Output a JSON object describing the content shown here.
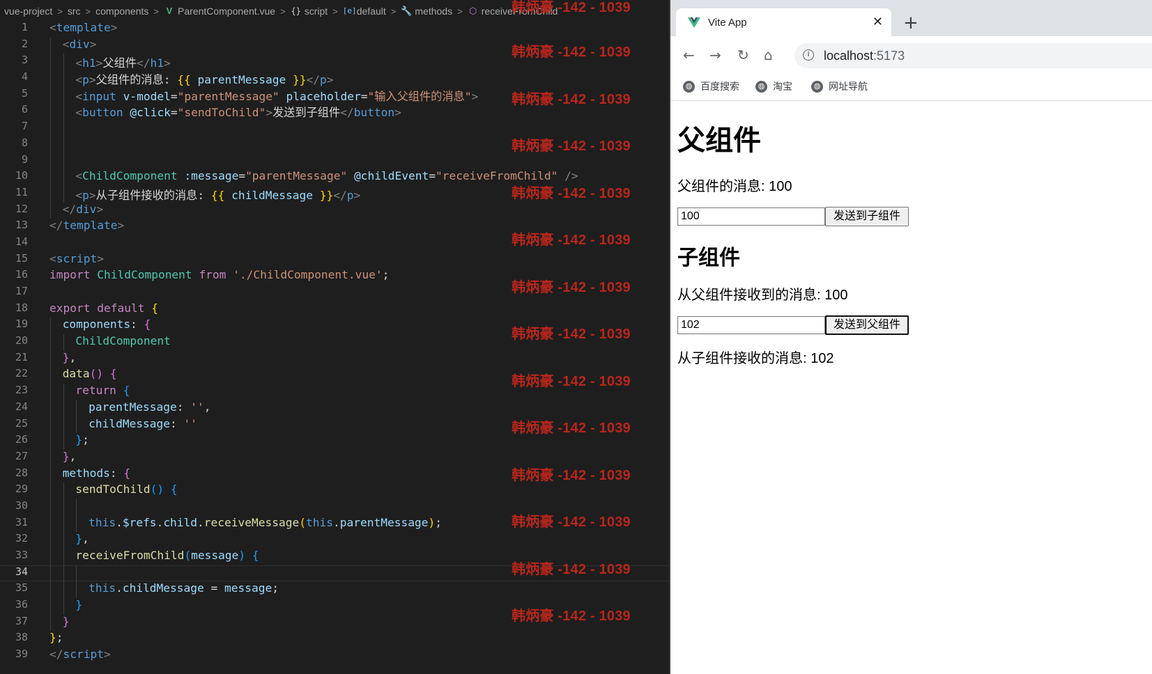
{
  "breadcrumb": {
    "items": [
      {
        "label": "vue-project",
        "icon": ""
      },
      {
        "label": "src",
        "icon": ""
      },
      {
        "label": "components",
        "icon": ""
      },
      {
        "label": "ParentComponent.vue",
        "icon": "vue-logo-icon"
      },
      {
        "label": "script",
        "icon": "braces-icon"
      },
      {
        "label": "default",
        "icon": "module-icon"
      },
      {
        "label": "methods",
        "icon": "wrench-icon"
      },
      {
        "label": "receiveFromChild",
        "icon": "cube-icon"
      }
    ]
  },
  "editor": {
    "current_line": 34,
    "lines": [
      {
        "n": "1",
        "indent": 0,
        "tokens": [
          [
            "p",
            "<"
          ],
          [
            "t",
            "template"
          ],
          [
            "p",
            ">"
          ]
        ]
      },
      {
        "n": "2",
        "indent": 1,
        "tokens": [
          [
            "p",
            "<"
          ],
          [
            "t",
            "div"
          ],
          [
            "p",
            ">"
          ]
        ]
      },
      {
        "n": "3",
        "indent": 2,
        "tokens": [
          [
            "p",
            "<"
          ],
          [
            "t",
            "h1"
          ],
          [
            "p",
            ">"
          ],
          [
            "d",
            "父组件"
          ],
          [
            "p",
            "</"
          ],
          [
            "t",
            "h1"
          ],
          [
            "p",
            ">"
          ]
        ]
      },
      {
        "n": "4",
        "indent": 2,
        "tokens": [
          [
            "p",
            "<"
          ],
          [
            "t",
            "p"
          ],
          [
            "p",
            ">"
          ],
          [
            "d",
            "父组件的消息: "
          ],
          [
            "y",
            "{{ "
          ],
          [
            "a",
            "parentMessage"
          ],
          [
            "y",
            " }}"
          ],
          [
            "p",
            "</"
          ],
          [
            "t",
            "p"
          ],
          [
            "p",
            ">"
          ]
        ]
      },
      {
        "n": "5",
        "indent": 2,
        "tokens": [
          [
            "p",
            "<"
          ],
          [
            "t",
            "input"
          ],
          [
            "d",
            " "
          ],
          [
            "a",
            "v-model"
          ],
          [
            "d",
            "="
          ],
          [
            "s",
            "\"parentMessage\""
          ],
          [
            "d",
            " "
          ],
          [
            "a",
            "placeholder"
          ],
          [
            "d",
            "="
          ],
          [
            "s",
            "\"输入父组件的消息\""
          ],
          [
            "p",
            ">"
          ]
        ]
      },
      {
        "n": "6",
        "indent": 2,
        "tokens": [
          [
            "p",
            "<"
          ],
          [
            "t",
            "button"
          ],
          [
            "d",
            " "
          ],
          [
            "a",
            "@click"
          ],
          [
            "d",
            "="
          ],
          [
            "s",
            "\"sendToChild\""
          ],
          [
            "p",
            ">"
          ],
          [
            "d",
            "发送到子组件"
          ],
          [
            "p",
            "</"
          ],
          [
            "t",
            "button"
          ],
          [
            "p",
            ">"
          ]
        ]
      },
      {
        "n": "7",
        "indent": 2,
        "tokens": []
      },
      {
        "n": "8",
        "indent": 2,
        "tokens": []
      },
      {
        "n": "9",
        "indent": 2,
        "tokens": []
      },
      {
        "n": "10",
        "indent": 2,
        "tokens": [
          [
            "p",
            "<"
          ],
          [
            "c",
            "ChildComponent"
          ],
          [
            "d",
            " "
          ],
          [
            "a",
            ":message"
          ],
          [
            "d",
            "="
          ],
          [
            "s",
            "\"parentMessage\""
          ],
          [
            "d",
            " "
          ],
          [
            "a",
            "@childEvent"
          ],
          [
            "d",
            "="
          ],
          [
            "s",
            "\"receiveFromChild\""
          ],
          [
            "d",
            " "
          ],
          [
            "p",
            "/>"
          ]
        ]
      },
      {
        "n": "11",
        "indent": 2,
        "tokens": [
          [
            "p",
            "<"
          ],
          [
            "t",
            "p"
          ],
          [
            "p",
            ">"
          ],
          [
            "d",
            "从子组件接收的消息: "
          ],
          [
            "y",
            "{{ "
          ],
          [
            "a",
            "childMessage"
          ],
          [
            "y",
            " }}"
          ],
          [
            "p",
            "</"
          ],
          [
            "t",
            "p"
          ],
          [
            "p",
            ">"
          ]
        ]
      },
      {
        "n": "12",
        "indent": 1,
        "tokens": [
          [
            "p",
            "</"
          ],
          [
            "t",
            "div"
          ],
          [
            "p",
            ">"
          ]
        ]
      },
      {
        "n": "13",
        "indent": 0,
        "tokens": [
          [
            "p",
            "</"
          ],
          [
            "t",
            "template"
          ],
          [
            "p",
            ">"
          ]
        ]
      },
      {
        "n": "14",
        "indent": 0,
        "tokens": []
      },
      {
        "n": "15",
        "indent": 0,
        "tokens": [
          [
            "p",
            "<"
          ],
          [
            "t",
            "script"
          ],
          [
            "p",
            ">"
          ]
        ]
      },
      {
        "n": "16",
        "indent": 0,
        "tokens": [
          [
            "k",
            "import"
          ],
          [
            "d",
            " "
          ],
          [
            "c",
            "ChildComponent"
          ],
          [
            "d",
            " "
          ],
          [
            "k",
            "from"
          ],
          [
            "d",
            " "
          ],
          [
            "s",
            "'./ChildComponent.vue'"
          ],
          [
            "d",
            ";"
          ]
        ]
      },
      {
        "n": "17",
        "indent": 0,
        "tokens": []
      },
      {
        "n": "18",
        "indent": 0,
        "tokens": [
          [
            "k",
            "export"
          ],
          [
            "d",
            " "
          ],
          [
            "k",
            "default"
          ],
          [
            "d",
            " "
          ],
          [
            "y",
            "{"
          ]
        ]
      },
      {
        "n": "19",
        "indent": 1,
        "tokens": [
          [
            "a",
            "components"
          ],
          [
            "d",
            ": "
          ],
          [
            "m",
            "{"
          ]
        ]
      },
      {
        "n": "20",
        "indent": 2,
        "tokens": [
          [
            "c",
            "ChildComponent"
          ]
        ]
      },
      {
        "n": "21",
        "indent": 1,
        "tokens": [
          [
            "m",
            "}"
          ],
          [
            "d",
            ","
          ]
        ]
      },
      {
        "n": "22",
        "indent": 1,
        "tokens": [
          [
            "f",
            "data"
          ],
          [
            "m",
            "()"
          ],
          [
            "d",
            " "
          ],
          [
            "m",
            "{"
          ]
        ]
      },
      {
        "n": "23",
        "indent": 2,
        "tokens": [
          [
            "k",
            "return"
          ],
          [
            "d",
            " "
          ],
          [
            "b",
            "{"
          ]
        ]
      },
      {
        "n": "24",
        "indent": 3,
        "tokens": [
          [
            "a",
            "parentMessage"
          ],
          [
            "d",
            ": "
          ],
          [
            "s",
            "''"
          ],
          [
            "d",
            ","
          ]
        ]
      },
      {
        "n": "25",
        "indent": 3,
        "tokens": [
          [
            "a",
            "childMessage"
          ],
          [
            "d",
            ": "
          ],
          [
            "s",
            "''"
          ]
        ]
      },
      {
        "n": "26",
        "indent": 2,
        "tokens": [
          [
            "b",
            "}"
          ],
          [
            "d",
            ";"
          ]
        ]
      },
      {
        "n": "27",
        "indent": 1,
        "tokens": [
          [
            "m",
            "}"
          ],
          [
            "d",
            ","
          ]
        ]
      },
      {
        "n": "28",
        "indent": 1,
        "tokens": [
          [
            "a",
            "methods"
          ],
          [
            "d",
            ": "
          ],
          [
            "m",
            "{"
          ]
        ]
      },
      {
        "n": "29",
        "indent": 2,
        "tokens": [
          [
            "f",
            "sendToChild"
          ],
          [
            "b",
            "()"
          ],
          [
            "d",
            " "
          ],
          [
            "b",
            "{"
          ]
        ]
      },
      {
        "n": "30",
        "indent": 3,
        "tokens": []
      },
      {
        "n": "31",
        "indent": 3,
        "tokens": [
          [
            "bl",
            "this"
          ],
          [
            "d",
            "."
          ],
          [
            "a",
            "$refs"
          ],
          [
            "d",
            "."
          ],
          [
            "a",
            "child"
          ],
          [
            "d",
            "."
          ],
          [
            "f",
            "receiveMessage"
          ],
          [
            "y",
            "("
          ],
          [
            "bl",
            "this"
          ],
          [
            "d",
            "."
          ],
          [
            "a",
            "parentMessage"
          ],
          [
            "y",
            ")"
          ],
          [
            "d",
            ";"
          ]
        ]
      },
      {
        "n": "32",
        "indent": 2,
        "tokens": [
          [
            "b",
            "}"
          ],
          [
            "d",
            ","
          ]
        ]
      },
      {
        "n": "33",
        "indent": 2,
        "tokens": [
          [
            "f",
            "receiveFromChild"
          ],
          [
            "b",
            "("
          ],
          [
            "a",
            "message"
          ],
          [
            "b",
            ")"
          ],
          [
            "d",
            " "
          ],
          [
            "b",
            "{"
          ]
        ]
      },
      {
        "n": "34",
        "indent": 3,
        "tokens": []
      },
      {
        "n": "35",
        "indent": 3,
        "tokens": [
          [
            "bl",
            "this"
          ],
          [
            "d",
            "."
          ],
          [
            "a",
            "childMessage"
          ],
          [
            "d",
            " = "
          ],
          [
            "a",
            "message"
          ],
          [
            "d",
            ";"
          ]
        ]
      },
      {
        "n": "36",
        "indent": 2,
        "tokens": [
          [
            "b",
            "}"
          ]
        ]
      },
      {
        "n": "37",
        "indent": 1,
        "tokens": [
          [
            "m",
            "}"
          ]
        ]
      },
      {
        "n": "38",
        "indent": 0,
        "tokens": [
          [
            "y",
            "}"
          ],
          [
            "d",
            ";"
          ]
        ]
      },
      {
        "n": "39",
        "indent": 0,
        "tokens": [
          [
            "p",
            "</"
          ],
          [
            "t",
            "script"
          ],
          [
            "p",
            ">"
          ]
        ]
      }
    ]
  },
  "watermark": {
    "text": "韩炳豪 -142 - 1039",
    "color": "#b7261c"
  },
  "browser": {
    "tab_title": "Vite App",
    "tab_close": "✕",
    "new_tab": "+",
    "nav": {
      "back": "←",
      "forward": "→",
      "reload": "↻",
      "home": "⌂"
    },
    "url_host": "localhost",
    "url_port": ":5173",
    "bookmarks": [
      "百度搜索",
      "淘宝",
      "网址导航"
    ]
  },
  "page": {
    "parent_title": "父组件",
    "parent_message_label": "父组件的消息: 100",
    "parent_input_value": "100",
    "parent_input_placeholder": "输入父组件的消息",
    "send_to_child_label": "发送到子组件",
    "child_title": "子组件",
    "child_received_label": "从父组件接收到的消息: 100",
    "child_input_value": "102",
    "send_to_parent_label": "发送到父组件",
    "received_from_child_label": "从子组件接收的消息: 102"
  },
  "colors": {
    "editor_bg": "#1e1e1e",
    "vue_green": "#42b883",
    "browser_tabstrip": "#dee1e6"
  }
}
